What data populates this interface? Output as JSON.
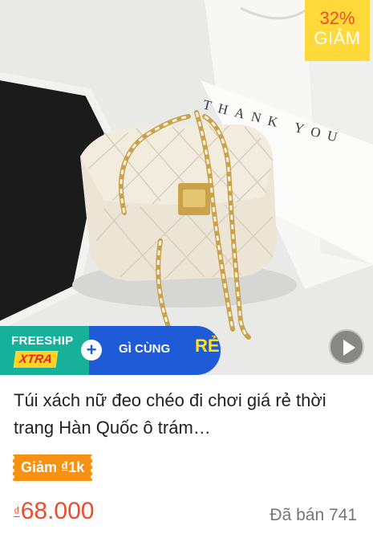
{
  "product": {
    "discount_badge": {
      "percent": "32%",
      "label": "GIẢM"
    },
    "promo_banner": {
      "freeship": "FREESHIP",
      "xtra": "XTRA",
      "plus": "+",
      "combo_text": "GÌ CÙNG",
      "combo_highlight": "RẺ"
    },
    "box_text": "THANK YOU",
    "title": "Túi xách nữ đeo chéo đi chơi giá rẻ thời trang Hàn Quốc ô trám…",
    "voucher": "Giảm ₫1k",
    "price_currency": "₫",
    "price": "68.000",
    "sold": "Đã bán 741"
  },
  "colors": {
    "accent": "#ee4d2d",
    "badge_bg": "#ffd839",
    "voucher_bg": "#f69113",
    "freeship_bg": "#17b19b",
    "combo_bg": "#1f5bd6"
  },
  "icons": {
    "play": "play-icon",
    "plus": "plus-icon"
  }
}
